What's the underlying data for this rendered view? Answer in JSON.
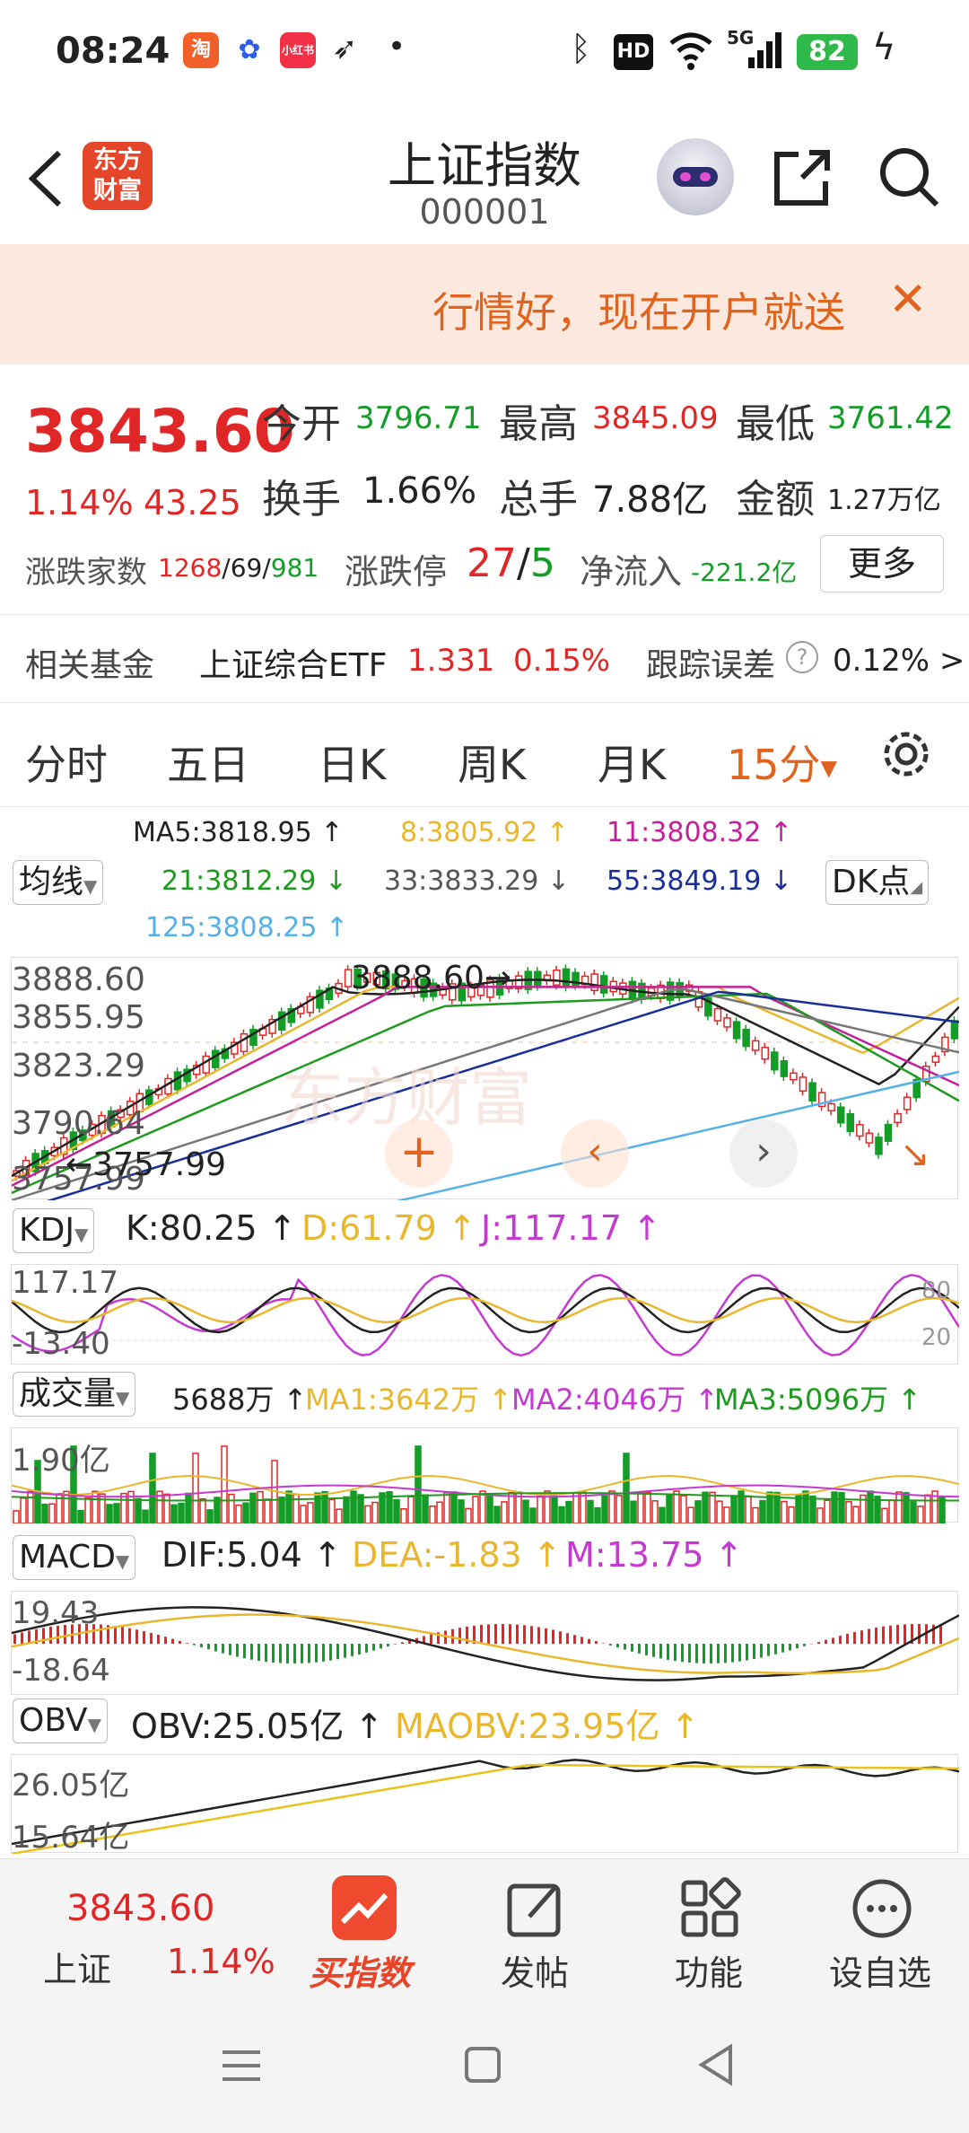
{
  "status": {
    "time": "08:24",
    "battery": "82",
    "net": "5G"
  },
  "header": {
    "title": "上证指数",
    "code": "000001",
    "logo_line1": "东方",
    "logo_line2": "财富"
  },
  "banner": {
    "text": "行情好，现在开户就送",
    "close": "✕"
  },
  "quote": {
    "price": "3843.60",
    "change_pct": "1.14%",
    "change": "43.25",
    "open_label": "今开",
    "open": "3796.71",
    "high_label": "最高",
    "high": "3845.09",
    "low_label": "最低",
    "low": "3761.42",
    "turnover_label": "换手",
    "turnover": "1.66%",
    "volume_label": "总手",
    "volume": "7.88亿",
    "amount_label": "金额",
    "amount": "1.27万亿",
    "breadth_label": "涨跌家数",
    "breadth_up": "1268",
    "breadth_flat": "/69/",
    "breadth_down": "981",
    "limit_label": "涨跌停",
    "limit_up": "27",
    "limit_sep": "/",
    "limit_down": "5",
    "inflow_label": "净流入",
    "inflow": "-221.2亿",
    "more_button": "更多"
  },
  "fund": {
    "label": "相关基金",
    "name": "上证综合ETF",
    "price": "1.331",
    "pct": "0.15%",
    "track_label": "跟踪误差",
    "track_value": "0.12% >"
  },
  "tabs": [
    "分时",
    "五日",
    "日K",
    "周K",
    "月K",
    "15分"
  ],
  "ma": {
    "selector": "均线",
    "dk": "DK点",
    "ma5": "MA5:3818.95 ↑",
    "ma8": "8:3805.92 ↑",
    "ma11": "11:3808.32 ↑",
    "ma21": "21:3812.29 ↓",
    "ma33": "33:3833.29 ↓",
    "ma55": "55:3849.19 ↓",
    "ma125": "125:3808.25 ↑"
  },
  "kline": {
    "y_labels": [
      "3888.60",
      "3855.95",
      "3823.29",
      "3790.64",
      "3757.99"
    ],
    "max_marker": "3888.60→",
    "min_marker": "←3757.99",
    "watermark": "东方财富"
  },
  "kdj": {
    "selector": "KDJ",
    "k": "K:80.25 ↑",
    "d": "D:61.79 ↑",
    "j": "J:117.17 ↑",
    "y_top": "117.17",
    "y_bottom": "-13.40",
    "level_high": "80",
    "level_low": "20"
  },
  "vol": {
    "selector": "成交量",
    "v": "5688万 ↑",
    "ma1": "MA1:3642万 ↑",
    "ma2": "MA2:4046万 ↑",
    "ma3": "MA3:5096万 ↑",
    "y_top": "1.90亿"
  },
  "macd": {
    "selector": "MACD",
    "dif": "DIF:5.04 ↑",
    "dea": "DEA:-1.83 ↑",
    "m": "M:13.75 ↑",
    "y_top": "19.43",
    "y_bottom": "-18.64"
  },
  "obv": {
    "selector": "OBV",
    "obv": "OBV:25.05亿 ↑",
    "maobv": "MAOBV:23.95亿 ↑",
    "y_top": "26.05亿",
    "y_bottom": "15.64亿"
  },
  "bottom": {
    "price": "3843.60",
    "name": "上证",
    "pct": "1.14%",
    "buy": "买指数",
    "post": "发帖",
    "func": "功能",
    "watch": "设自选"
  },
  "colors": {
    "up": "#e02626",
    "down": "#139c27",
    "accent": "#e0641d"
  }
}
